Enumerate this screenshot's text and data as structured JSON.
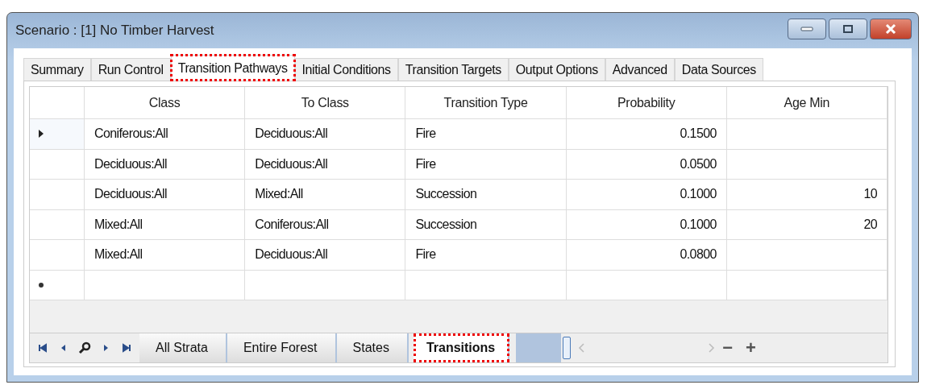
{
  "window": {
    "title": "Scenario : [1] No Timber Harvest"
  },
  "tabs": [
    {
      "label": "Summary",
      "selected": false,
      "highlighted": false
    },
    {
      "label": "Run Control",
      "selected": false,
      "highlighted": false
    },
    {
      "label": "Transition Pathways",
      "selected": true,
      "highlighted": true
    },
    {
      "label": "Initial Conditions",
      "selected": false,
      "highlighted": false
    },
    {
      "label": "Transition Targets",
      "selected": false,
      "highlighted": false
    },
    {
      "label": "Output Options",
      "selected": false,
      "highlighted": false
    },
    {
      "label": "Advanced",
      "selected": false,
      "highlighted": false
    },
    {
      "label": "Data Sources",
      "selected": false,
      "highlighted": false
    }
  ],
  "table": {
    "columns": [
      {
        "label": "Class"
      },
      {
        "label": "To Class"
      },
      {
        "label": "Transition Type"
      },
      {
        "label": "Probability"
      },
      {
        "label": "Age Min"
      }
    ],
    "rows": [
      {
        "current": true,
        "cells": [
          "Coniferous:All",
          "Deciduous:All",
          "Fire",
          "0.1500",
          ""
        ]
      },
      {
        "current": false,
        "cells": [
          "Deciduous:All",
          "Deciduous:All",
          "Fire",
          "0.0500",
          ""
        ]
      },
      {
        "current": false,
        "cells": [
          "Deciduous:All",
          "Mixed:All",
          "Succession",
          "0.1000",
          "10"
        ]
      },
      {
        "current": false,
        "cells": [
          "Mixed:All",
          "Coniferous:All",
          "Succession",
          "0.1000",
          "20"
        ]
      },
      {
        "current": false,
        "cells": [
          "Mixed:All",
          "Deciduous:All",
          "Fire",
          "0.0800",
          ""
        ]
      }
    ],
    "new_row": true
  },
  "sheet_tabs": [
    {
      "label": "All Strata",
      "selected": false,
      "highlighted": false
    },
    {
      "label": "Entire Forest",
      "selected": false,
      "highlighted": false
    },
    {
      "label": "States",
      "selected": false,
      "highlighted": false
    },
    {
      "label": "Transitions",
      "selected": true,
      "highlighted": true
    }
  ],
  "sheet_buttons": [
    "−",
    "+"
  ]
}
